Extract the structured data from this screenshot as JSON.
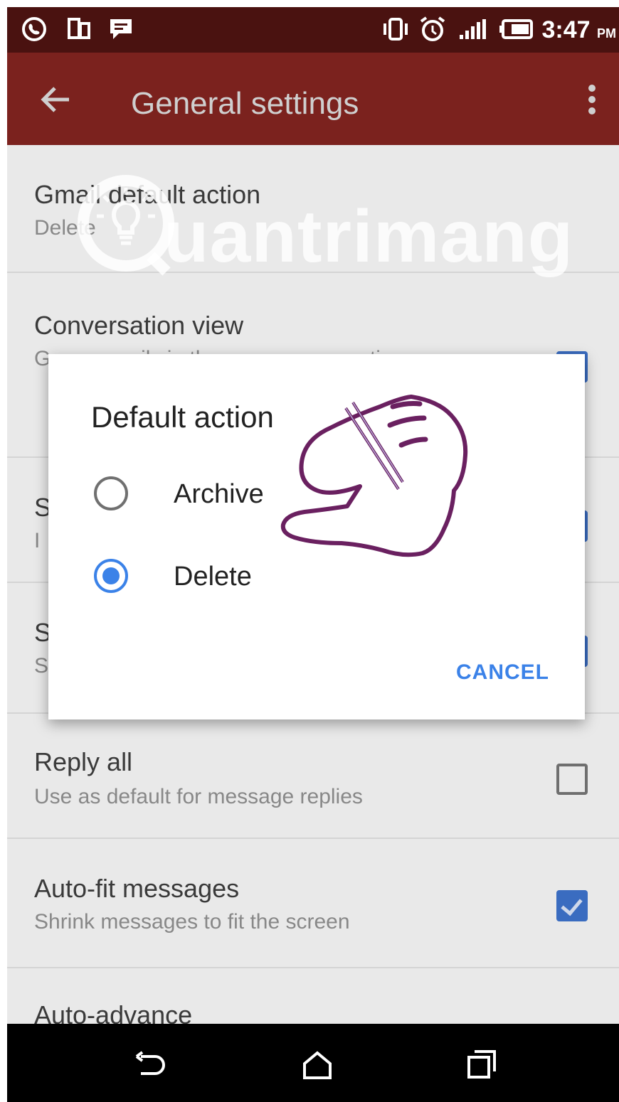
{
  "status_bar": {
    "time": "3:47",
    "ampm": "PM",
    "icons": [
      "viber-icon",
      "dual-screen-icon",
      "message-icon",
      "vibrate-icon",
      "alarm-icon",
      "signal-icon",
      "battery-icon"
    ]
  },
  "app_bar": {
    "title": "General settings",
    "back_icon": "arrow-left-icon",
    "menu_icon": "more-vert-icon"
  },
  "settings": [
    {
      "title": "Gmail default action",
      "subtitle": "Delete"
    },
    {
      "title": "Conversation view",
      "subtitle": "Group emails in the same conversation",
      "checked": true
    },
    {
      "title": "S",
      "subtitle": "I",
      "checked": true
    },
    {
      "title": "S",
      "subtitle": "S",
      "checked": true
    },
    {
      "title": "Reply all",
      "subtitle": "Use as default for message replies",
      "checked": false
    },
    {
      "title": "Auto-fit messages",
      "subtitle": "Shrink messages to fit the screen",
      "checked": true
    },
    {
      "title": "Auto-advance"
    }
  ],
  "dialog": {
    "title": "Default action",
    "options": [
      {
        "label": "Archive",
        "selected": false
      },
      {
        "label": "Delete",
        "selected": true
      }
    ],
    "cancel_label": "CANCEL"
  },
  "watermark": {
    "text": "uantrimang"
  },
  "colors": {
    "status_bar": "#4a1210",
    "app_bar": "#7b221e",
    "accent": "#3b82e8",
    "checkbox": "#3a6cc0",
    "hand_outline": "#6a2060"
  },
  "nav_bar": {
    "icons": [
      "back-nav-icon",
      "home-icon",
      "recents-icon"
    ]
  }
}
